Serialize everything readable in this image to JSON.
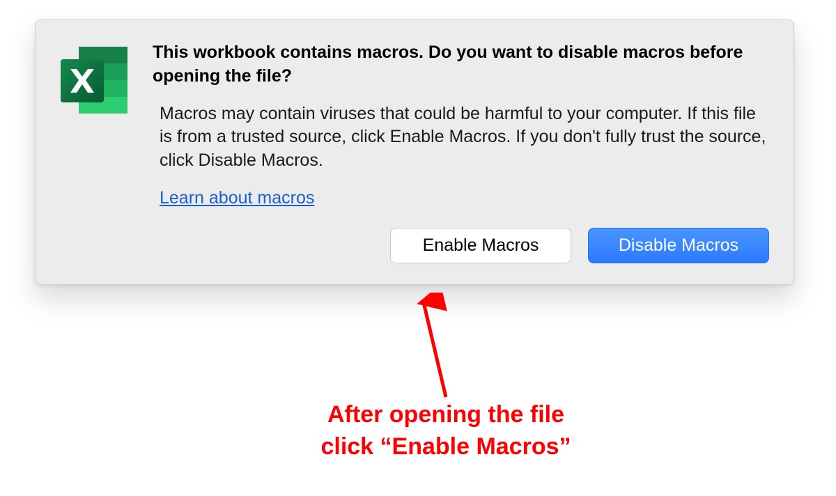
{
  "dialog": {
    "heading": "This workbook contains macros. Do you want to disable macros before opening the file?",
    "body": "Macros may contain viruses that could be harmful to your computer.  If this file is from a trusted source, click Enable Macros. If you don't fully trust the source, click Disable Macros.",
    "learn_link": "Learn about macros",
    "enable_label": "Enable Macros",
    "disable_label": "Disable Macros"
  },
  "annotation": {
    "line1": "After opening the file",
    "line2": "click “Enable Macros”"
  },
  "colors": {
    "accent_red": "#ff0000",
    "link_blue": "#1b5fcc",
    "primary_button": "#2b7bff",
    "excel_green_dark": "#0e6b3d",
    "excel_green": "#1b9e56",
    "excel_green_light": "#2ecc71"
  }
}
